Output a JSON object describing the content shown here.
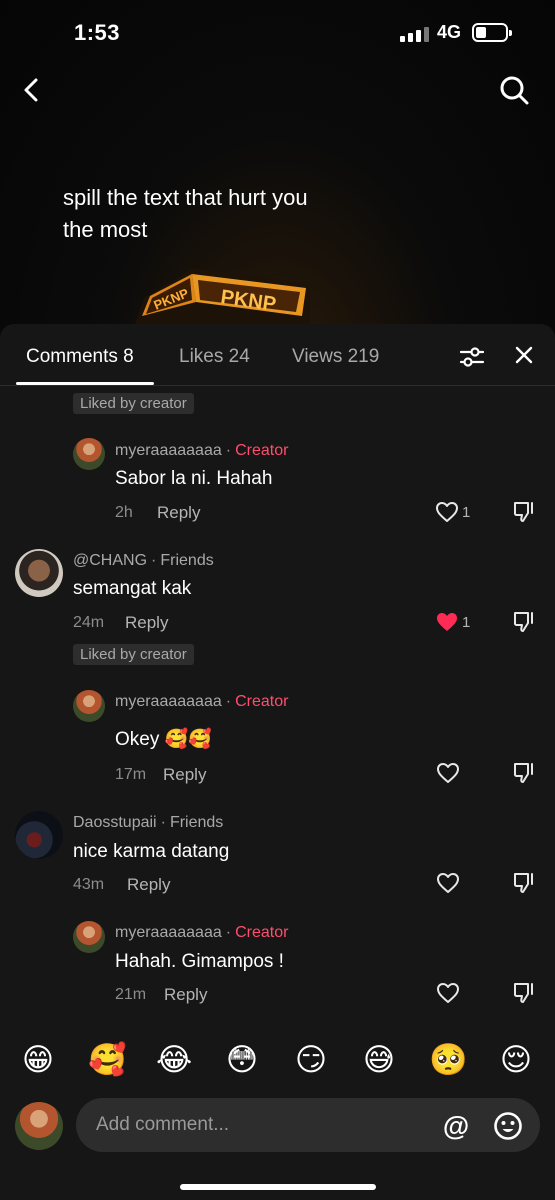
{
  "status_bar": {
    "time": "1:53",
    "network": "4G"
  },
  "video": {
    "caption": "spill the text that hurt you the most",
    "sign_text": "PKNP"
  },
  "tabs": [
    {
      "label": "Comments 8",
      "active": true
    },
    {
      "label": "Likes 24",
      "active": false
    },
    {
      "label": "Views 219",
      "active": false
    }
  ],
  "badges": {
    "liked_by_creator": "Liked by creator"
  },
  "comments": [
    {
      "user": "myeraaaaaaaa",
      "tag": "Creator",
      "text": "Sabor la ni. Hahah",
      "time": "2h",
      "reply": "Reply",
      "likes": "1",
      "liked": false
    },
    {
      "user": "@CHANG",
      "tag": "Friends",
      "text": "semangat kak",
      "time": "24m",
      "reply": "Reply",
      "likes": "1",
      "liked": true
    },
    {
      "user": "myeraaaaaaaa",
      "tag": "Creator",
      "text": "Okey 🥰🥰",
      "time": "17m",
      "reply": "Reply",
      "likes": "",
      "liked": false
    },
    {
      "user": "Daosstupaii",
      "tag": "Friends",
      "text": "nice karma datang",
      "time": "43m",
      "reply": "Reply",
      "likes": "",
      "liked": false
    },
    {
      "user": "myeraaaaaaaa",
      "tag": "Creator",
      "text": "Hahah. Gimampos !",
      "time": "21m",
      "reply": "Reply",
      "likes": "",
      "liked": false
    }
  ],
  "emoji_bar": [
    "😁",
    "🥰",
    "😂",
    "😳",
    "😏",
    "😅",
    "🥺",
    "😌"
  ],
  "input": {
    "placeholder": "Add comment...",
    "at_symbol": "@"
  },
  "colors": {
    "creator_tag": "#ff4d6d",
    "liked_heart": "#fe2c55",
    "sheet_bg": "#161616"
  }
}
